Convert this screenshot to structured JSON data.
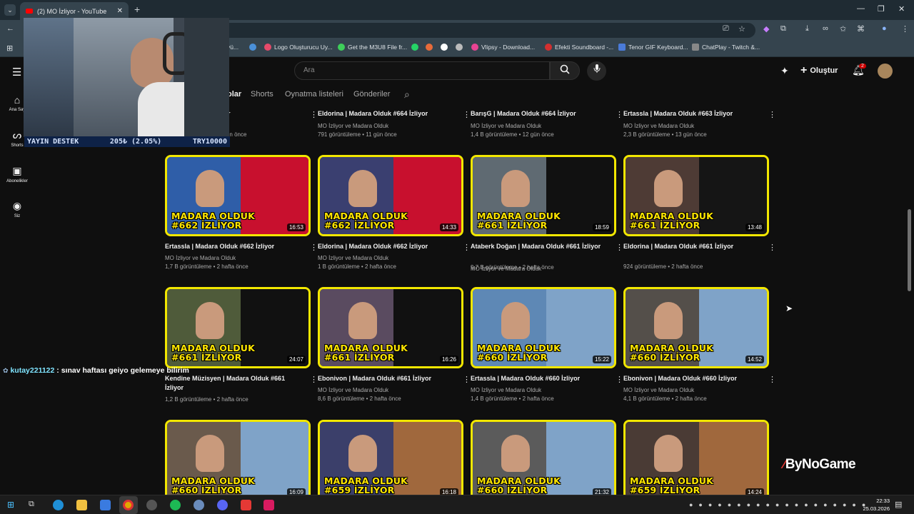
{
  "browser": {
    "tab_title": "(2) MO İzliyor - YouTube",
    "bookmarks": [
      "yü...",
      "Logo Oluşturucu Uy...",
      "Get the M3U8 File fr...",
      "Vlipsy - Download...",
      "Efekti Soundboard -...",
      "Tenor GIF Keyboard...",
      "ChatPlay - Twitch &..."
    ]
  },
  "youtube": {
    "search_placeholder": "Ara",
    "create_label": "Oluştur",
    "notification_count": "2",
    "sidebar": [
      {
        "label": "Ana Say",
        "icon": "home-icon"
      },
      {
        "label": "Shorts",
        "icon": "shorts-icon"
      },
      {
        "label": "Abonelikler",
        "icon": "subscriptions-icon"
      },
      {
        "label": "Siz",
        "icon": "profile-icon"
      }
    ],
    "channel_tabs": [
      "olar",
      "Shorts",
      "Oynatma listeleri",
      "Gönderiler"
    ]
  },
  "top_row": [
    {
      "title": "...a Olduk #665 İzliyor",
      "channel": "",
      "meta": "12 B görüntüleme • 10 gün önce"
    },
    {
      "title": "Eldorina | Madara Olduk #664 İzliyor",
      "channel": "MO İzliyor ve Madara Olduk",
      "meta": "791 görüntüleme • 11 gün önce"
    },
    {
      "title": "BarışG | Madara Olduk #664 İzliyor",
      "channel": "MO İzliyor ve Madara Olduk",
      "meta": "1,4 B görüntüleme • 12 gün önce"
    },
    {
      "title": "Ertassla | Madara Olduk #663 İzliyor",
      "channel": "MO İzliyor ve Madara Olduk",
      "meta": "2,3 B görüntüleme • 13 gün önce"
    }
  ],
  "rows": [
    [
      {
        "title": "Ertassla | Madara Olduk #662 İzliyor",
        "channel": "MO İzliyor ve Madara Olduk",
        "meta": "1,7 B görüntüleme • 2 hafta önce",
        "caption1": "MADARA OLDUK",
        "caption2": "#662 İZLİYOR",
        "duration": "16:53"
      },
      {
        "title": "Eldorina | Madara Olduk #662 İzliyor",
        "channel": "MO İzliyor ve Madara Olduk",
        "meta": "1 B görüntüleme • 2 hafta önce",
        "caption1": "MADARA OLDUK",
        "caption2": "#662 İZLİYOR",
        "duration": "14:33"
      },
      {
        "title": "Ataberk Doğan | Madara Olduk #661 İzliyor",
        "channel": "MO İzliyor ve Madara Olduk",
        "meta": "9,7 B görüntüleme • 2 hafta önce",
        "caption1": "MADARA OLDUK",
        "caption2": "#661 İZLİYOR",
        "duration": "18:59"
      },
      {
        "title": "Eldorina | Madara Olduk #661 İzliyor",
        "channel": "",
        "meta": "924 görüntüleme • 2 hafta önce",
        "caption1": "MADARA OLDUK",
        "caption2": "#661 İZLİYOR",
        "duration": "13:48"
      }
    ],
    [
      {
        "title": "Kendine Müzisyen | Madara Olduk #661 İzliyor",
        "channel": "",
        "meta": "1,2 B görüntüleme • 2 hafta önce",
        "caption1": "MADARA OLDUK",
        "caption2": "#661 İZLİYOR",
        "duration": "24:07"
      },
      {
        "title": "Ebonivon | Madara Olduk #661 İzliyor",
        "channel": "MO İzliyor ve Madara Olduk",
        "meta": "8,6 B görüntüleme • 2 hafta önce",
        "caption1": "MADARA OLDUK",
        "caption2": "#661 İZLİYOR",
        "duration": "16:26"
      },
      {
        "title": "Ertassla | Madara Olduk #660 İzliyor",
        "channel": "MO İzliyor ve Madara Olduk",
        "meta": "1,4 B görüntüleme • 2 hafta önce",
        "caption1": "MADARA OLDUK",
        "caption2": "#660 İZLİYOR",
        "duration": "15:22"
      },
      {
        "title": "Ebonivon | Madara Olduk #660 İzliyor",
        "channel": "MO İzliyor ve Madara Olduk",
        "meta": "4,1 B görüntüleme • 2 hafta önce",
        "caption1": "MADARA OLDUK",
        "caption2": "#660 İZLİYOR",
        "duration": "14:52"
      }
    ],
    [
      {
        "caption1": "MADARA OLDUK",
        "caption2": "#660 İZLİYOR",
        "duration": "16:09"
      },
      {
        "caption1": "MADARA OLDUK",
        "caption2": "#659 İZLİYOR",
        "duration": "16:18"
      },
      {
        "caption1": "MADARA OLDUK",
        "caption2": "#660 İZLİYOR",
        "duration": "21:32"
      },
      {
        "caption1": "MADARA OLDUK",
        "caption2": "#659 İZLİYOR",
        "duration": "14:24"
      }
    ]
  ],
  "overlay": {
    "donation_left": "YAYIN DESTEK",
    "donation_mid": "205₺ (2.05%)",
    "donation_right": "TRY10000",
    "chat_user": "kutay221122",
    "chat_msg": ": sınav haftası geiyo gelemeye bilirim",
    "watermark": "ByNoGame"
  },
  "taskbar": {
    "time": "22:33",
    "date": "25.03.2026"
  },
  "colors": {
    "accent_yellow": "#f2e700",
    "yt_red": "#ff0000",
    "bg": "#0f0f0f"
  }
}
